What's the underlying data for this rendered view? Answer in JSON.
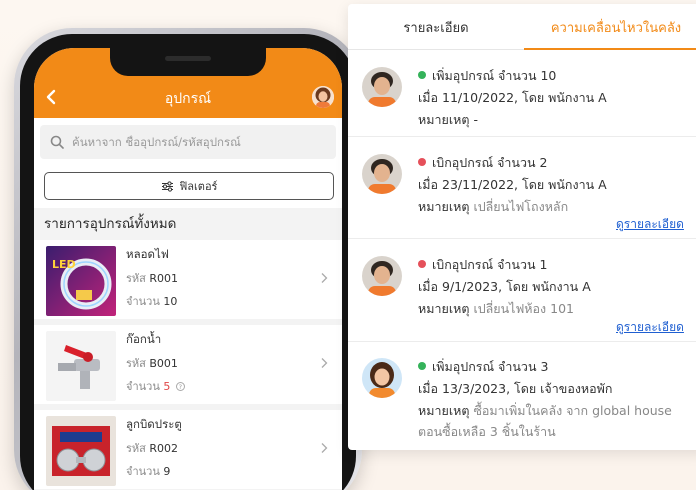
{
  "app": {
    "title": "อุปกรณ์",
    "search_placeholder": "ค้นหาจาก ชื่ออุปกรณ์/รหัสอุปกรณ์",
    "filter_label": "ฟิลเตอร์",
    "section_title": "รายการอุปกรณ์ทั้งหมด",
    "items": [
      {
        "name": "หลอดไฟ",
        "code_label": "รหัส",
        "code": "R001",
        "qty_label": "จำนวน",
        "qty": "10"
      },
      {
        "name": "ก๊อกน้ำ",
        "code_label": "รหัส",
        "code": "B001",
        "qty_label": "จำนวน",
        "qty": "5"
      },
      {
        "name": "ลูกบิดประตู",
        "code_label": "รหัส",
        "code": "R002",
        "qty_label": "จำนวน",
        "qty": "9"
      }
    ]
  },
  "panel": {
    "tabs": [
      {
        "label": "รายละเอียด",
        "active": false
      },
      {
        "label": "ความเคลื่อนไหวในคลัง",
        "active": true
      }
    ],
    "entries": [
      {
        "status_color": "#34b25a",
        "action": "เพิ่มอุปกรณ์ จำนวน 10",
        "when": "เมื่อ 11/10/2022, โดย พนักงาน A",
        "note_label": "หมายเหตุ",
        "note": "-",
        "note2": "",
        "link": ""
      },
      {
        "status_color": "#e5505a",
        "action": "เบิกอุปกรณ์ จำนวน 2",
        "when": "เมื่อ 23/11/2022, โดย พนักงาน A",
        "note_label": "หมายเหตุ",
        "note": "เปลี่ยนไฟโถงหลัก",
        "note2": "",
        "link": "ดูรายละเอียด"
      },
      {
        "status_color": "#e5505a",
        "action": "เบิกอุปกรณ์ จำนวน 1",
        "when": "เมื่อ 9/1/2023, โดย พนักงาน A",
        "note_label": "หมายเหตุ",
        "note": "เปลี่ยนไฟห้อง 101",
        "note2": "",
        "link": "ดูรายละเอียด"
      },
      {
        "status_color": "#34b25a",
        "action": "เพิ่มอุปกรณ์ จำนวน 3",
        "when": "เมื่อ 13/3/2023, โดย เจ้าของหอพัก",
        "note_label": "หมายเหตุ",
        "note": "ซื้อมาเพิ่มในคลัง จาก global house",
        "note2": "ตอนซื้อเหลือ 3 ชิ้นในร้าน",
        "link": ""
      }
    ]
  },
  "colors": {
    "brand": "#f28a17",
    "link": "#1f5fd1",
    "status_add": "#34b25a",
    "status_withdraw": "#e5505a"
  }
}
